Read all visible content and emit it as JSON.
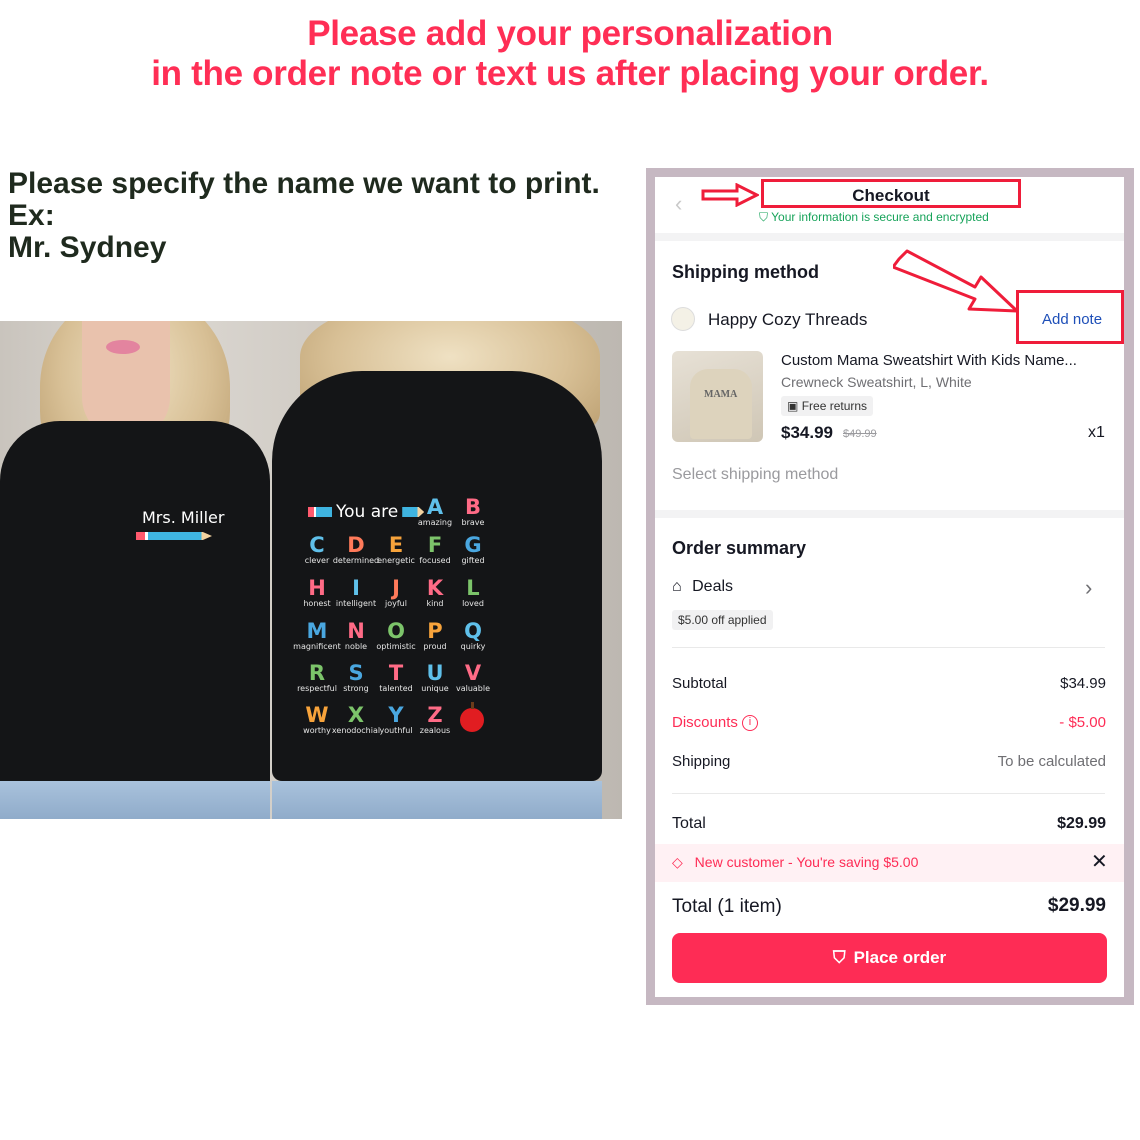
{
  "banner": {
    "line1": "Please add your personalization",
    "line2": "in the order note or text us after placing your order."
  },
  "instructions": {
    "line1": "Please specify the name we want to print.",
    "line2": "Ex:",
    "line3": "Mr. Sydney"
  },
  "photo": {
    "chest_name": "Mrs. Miller",
    "back_heading": "You are",
    "letters": [
      {
        "letter": "A",
        "word": "amazing",
        "color": "#5fc0ea"
      },
      {
        "letter": "B",
        "word": "brave",
        "color": "#ff6b86"
      },
      {
        "letter": "C",
        "word": "clever",
        "color": "#5fc0ea"
      },
      {
        "letter": "D",
        "word": "determined",
        "color": "#ff7a5a"
      },
      {
        "letter": "E",
        "word": "energetic",
        "color": "#f7a33b"
      },
      {
        "letter": "F",
        "word": "focused",
        "color": "#7cc46a"
      },
      {
        "letter": "G",
        "word": "gifted",
        "color": "#4aa7e0"
      },
      {
        "letter": "H",
        "word": "honest",
        "color": "#ff6b86"
      },
      {
        "letter": "I",
        "word": "intelligent",
        "color": "#5fc0ea"
      },
      {
        "letter": "J",
        "word": "joyful",
        "color": "#ff7a5a"
      },
      {
        "letter": "K",
        "word": "kind",
        "color": "#ff6b86"
      },
      {
        "letter": "L",
        "word": "loved",
        "color": "#7cc46a"
      },
      {
        "letter": "M",
        "word": "magnificent",
        "color": "#4aa7e0"
      },
      {
        "letter": "N",
        "word": "noble",
        "color": "#ff6b86"
      },
      {
        "letter": "O",
        "word": "optimistic",
        "color": "#7cc46a"
      },
      {
        "letter": "P",
        "word": "proud",
        "color": "#f7a33b"
      },
      {
        "letter": "Q",
        "word": "quirky",
        "color": "#5fc0ea"
      },
      {
        "letter": "R",
        "word": "respectful",
        "color": "#7cc46a"
      },
      {
        "letter": "S",
        "word": "strong",
        "color": "#4aa7e0"
      },
      {
        "letter": "T",
        "word": "talented",
        "color": "#ff6b86"
      },
      {
        "letter": "U",
        "word": "unique",
        "color": "#5fc0ea"
      },
      {
        "letter": "V",
        "word": "valuable",
        "color": "#ff6b86"
      },
      {
        "letter": "W",
        "word": "worthy",
        "color": "#f7a33b"
      },
      {
        "letter": "X",
        "word": "xenodochial",
        "color": "#7cc46a"
      },
      {
        "letter": "Y",
        "word": "youthful",
        "color": "#4aa7e0"
      },
      {
        "letter": "Z",
        "word": "zealous",
        "color": "#ff6b86"
      }
    ]
  },
  "checkout": {
    "title": "Checkout",
    "secure_text": "Your information is secure and encrypted",
    "shipping_heading": "Shipping method",
    "shop_name": "Happy Cozy Threads",
    "add_note": "Add note",
    "product": {
      "name": "Custom Mama Sweatshirt With Kids Name...",
      "variant": "Crewneck Sweatshirt, L, White",
      "badge": "Free returns",
      "price": "$34.99",
      "original_price": "$49.99",
      "quantity": "x1",
      "thumb_text": "MAMA"
    },
    "select_shipping": "Select shipping method",
    "summary_heading": "Order summary",
    "deals_label": "Deals",
    "deals_applied": "$5.00 off applied",
    "subtotal_label": "Subtotal",
    "subtotal_value": "$34.99",
    "discounts_label": "Discounts",
    "discounts_value": "- $5.00",
    "shipping_label": "Shipping",
    "shipping_value": "To be calculated",
    "total_label": "Total",
    "total_value": "$29.99",
    "promo_text": "New customer - You're saving $5.00",
    "footer_total_label": "Total",
    "footer_total_count": "(1 item)",
    "footer_total_value": "$29.99",
    "place_order": "Place order"
  },
  "colors": {
    "accent": "#fe2c55",
    "annotation_red": "#ef1d3a",
    "secure_green": "#17a35a",
    "link_blue": "#1e4fb8"
  }
}
